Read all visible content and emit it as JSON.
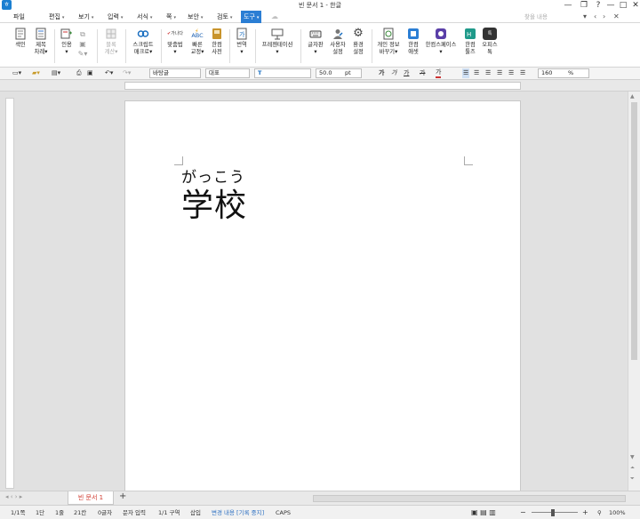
{
  "window": {
    "title": "빈 문서 1 - 한글",
    "controls": [
      "—",
      "❐",
      "?",
      "—",
      "□",
      "✕"
    ]
  },
  "menubar": {
    "file": "파일",
    "items": [
      "편집",
      "보기",
      "입력",
      "서식",
      "쪽",
      "보안",
      "검토",
      "도구"
    ],
    "search_placeholder": "찾을 내용"
  },
  "ribbon": {
    "tools": [
      {
        "l1": "색인",
        "l2": ""
      },
      {
        "l1": "제목",
        "l2": "차례"
      },
      {
        "l1": "인용",
        "l2": ""
      },
      {
        "l1": "블록",
        "l2": "계산"
      },
      {
        "l1": "스크립트",
        "l2": "매크로"
      },
      {
        "l1": "맞춤법",
        "l2": ""
      },
      {
        "l1": "빠른",
        "l2": "교정"
      },
      {
        "l1": "한컴",
        "l2": "사전"
      },
      {
        "l1": "번역",
        "l2": ""
      },
      {
        "l1": "프레젠테이션",
        "l2": ""
      },
      {
        "l1": "글자판",
        "l2": ""
      },
      {
        "l1": "사용자",
        "l2": "설정"
      },
      {
        "l1": "환경",
        "l2": "설정"
      },
      {
        "l1": "개인 정보",
        "l2": "바꾸기"
      },
      {
        "l1": "한컴",
        "l2": "애셋"
      },
      {
        "l1": "한컴스페이스",
        "l2": ""
      },
      {
        "l1": "한컴",
        "l2": "툴즈"
      },
      {
        "l1": "오피스",
        "l2": "톡"
      }
    ],
    "spell_icon_text": "가나다",
    "quick_icon_text": "ABC",
    "office_icon_text": "톡"
  },
  "format": {
    "style": "바탕글",
    "lang": "대표",
    "font": "",
    "size": "50.0",
    "size_unit": "pt",
    "bold": "가",
    "italic": "가",
    "underline": "가",
    "strike": "가",
    "color": "가",
    "zoom_value": "160",
    "zoom_unit": "%"
  },
  "document": {
    "ruby": "がっこう",
    "kanji": "学校"
  },
  "tabs": {
    "doc_tab": "빈 문서 1",
    "add": "+"
  },
  "status": {
    "page": "1/1쪽",
    "column": "1단",
    "line": "1줄",
    "col": "21칸",
    "chars": "0글자",
    "mode": "문자 입력",
    "section": "1/1 구역",
    "insert": "삽입",
    "change": "변경 내용 [기록 중지]",
    "caps": "CAPS",
    "zoom": "100%"
  },
  "colors": {
    "accent": "#2b7ed4",
    "workspace": "#e1e1e1",
    "tab_text": "#d03a2f"
  }
}
